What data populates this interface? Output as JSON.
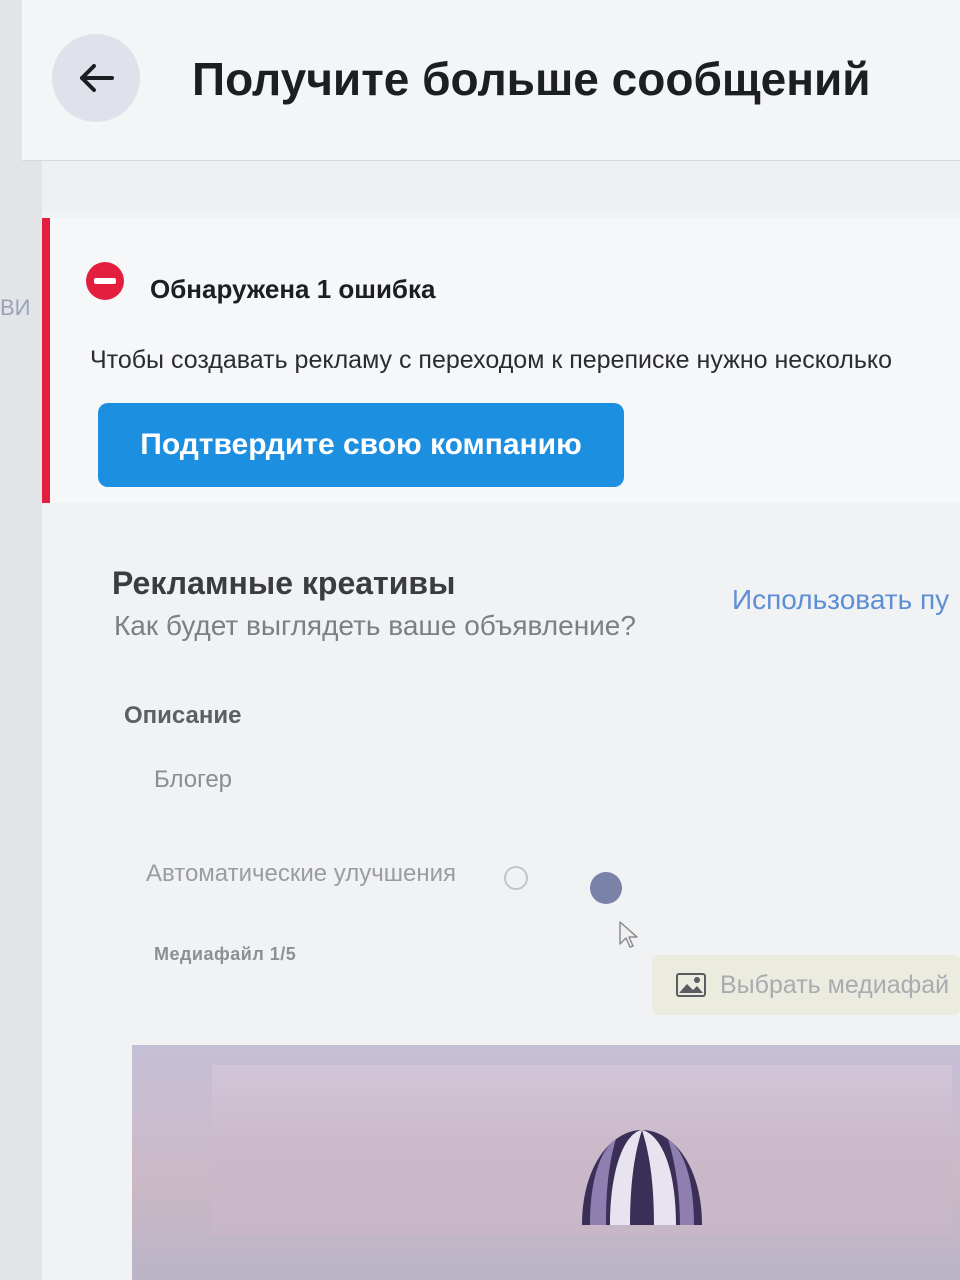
{
  "left_strip": {
    "fragments": [
      "ВИ"
    ]
  },
  "header": {
    "back_icon": "arrow-left-icon",
    "title": "Получите больше сообщений"
  },
  "error": {
    "icon": "error-stop-icon",
    "color": "#e41e3f",
    "title": "Обнаружена 1 ошибка",
    "text": "Чтобы создавать рекламу с переходом к переписке нужно несколько",
    "button_label": "Подтвердите свою компанию",
    "button_color": "#1d8fe0"
  },
  "creatives": {
    "title": "Рекламные креативы",
    "subtitle": "Как будет выглядеть ваше объявление?",
    "link_label": "Использовать пу"
  },
  "description": {
    "label": "Описание",
    "value": "Блогер"
  },
  "auto_improvements": {
    "label": "Автоматические улучшения",
    "info_icon": "info-icon"
  },
  "media": {
    "label": "Медиафайл 1/5",
    "choose_icon": "image-icon",
    "choose_label": "Выбрать медиафай"
  }
}
